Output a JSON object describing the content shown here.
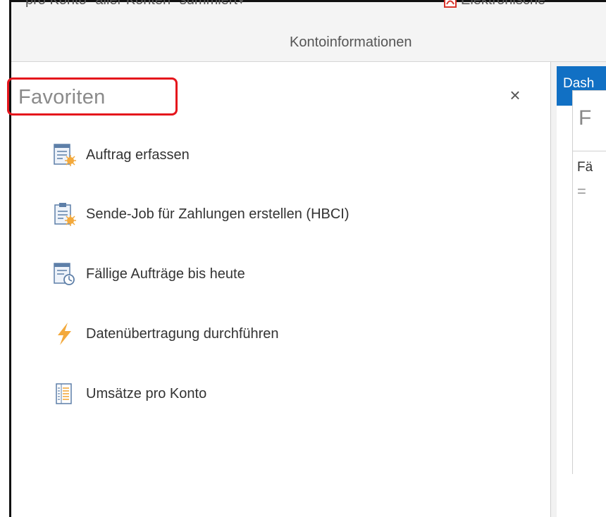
{
  "ribbon": {
    "summed_button_label": "pro Konto \"aller Konten\" summiert",
    "summed_caret": "▾",
    "einvoice_label": "Elektronische",
    "group_label": "Kontoinformationen"
  },
  "favorites": {
    "title": "Favoriten",
    "close_glyph": "×",
    "items": [
      {
        "label": "Auftrag erfassen",
        "icon": "order-new-icon"
      },
      {
        "label": "Sende-Job für Zahlungen erstellen (HBCI)",
        "icon": "send-job-clipboard-icon"
      },
      {
        "label": "Fällige Aufträge bis heute",
        "icon": "due-orders-clock-icon"
      },
      {
        "label": "Datenübertragung durchführen",
        "icon": "lightning-icon"
      },
      {
        "label": "Umsätze pro Konto",
        "icon": "ledger-icon"
      }
    ]
  },
  "dashboard": {
    "tab_label": "Dash",
    "card_title": "F",
    "card_subtitle": "Fä",
    "card_row": "="
  },
  "colors": {
    "highlight": "#e5151c",
    "accent_blue": "#1170c4",
    "icon_orange": "#f3a93c"
  }
}
